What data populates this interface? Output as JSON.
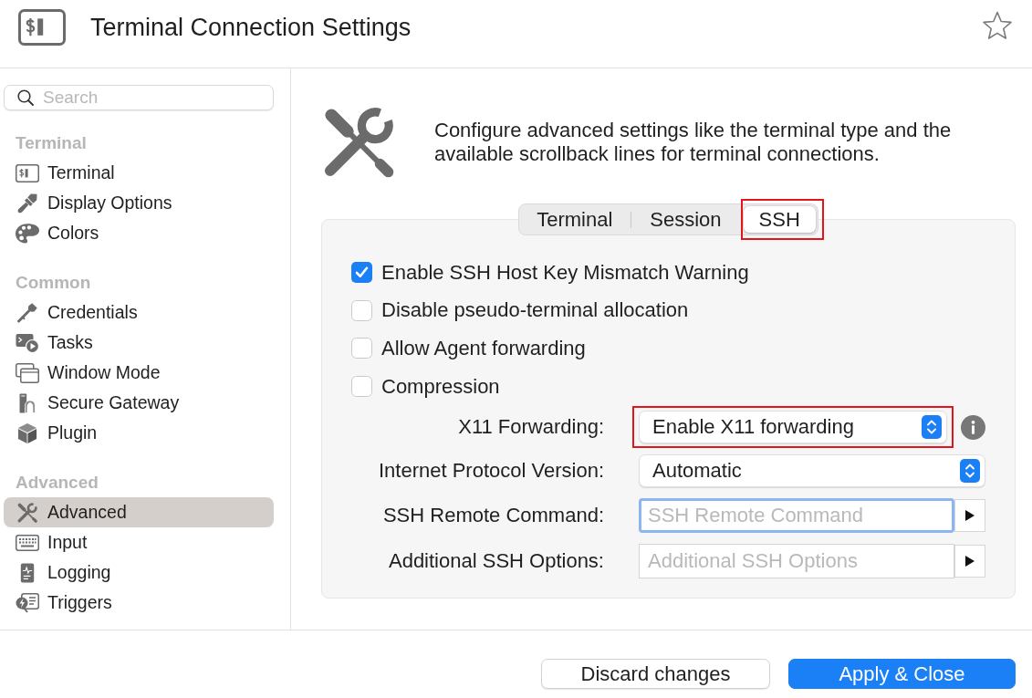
{
  "window": {
    "title": "Terminal Connection Settings",
    "favorite": false
  },
  "sidebar": {
    "search": {
      "placeholder": "Search"
    },
    "sections": [
      {
        "heading": "Terminal",
        "items": [
          {
            "label": "Terminal",
            "kind": "terminal",
            "selected": false
          },
          {
            "label": "Display Options",
            "kind": "paintbrush",
            "selected": false
          },
          {
            "label": "Colors",
            "kind": "palette",
            "selected": false
          }
        ]
      },
      {
        "heading": "Common",
        "items": [
          {
            "label": "Credentials",
            "kind": "key",
            "selected": false
          },
          {
            "label": "Tasks",
            "kind": "tasks",
            "selected": false
          },
          {
            "label": "Window Mode",
            "kind": "windows",
            "selected": false
          },
          {
            "label": "Secure Gateway",
            "kind": "gateway",
            "selected": false
          },
          {
            "label": "Plugin",
            "kind": "cube",
            "selected": false
          }
        ]
      },
      {
        "heading": "Advanced",
        "items": [
          {
            "label": "Advanced",
            "kind": "tools",
            "selected": true
          },
          {
            "label": "Input",
            "kind": "keyboard",
            "selected": false
          },
          {
            "label": "Logging",
            "kind": "logging",
            "selected": false
          },
          {
            "label": "Triggers",
            "kind": "triggers",
            "selected": false
          }
        ]
      }
    ]
  },
  "intro": {
    "description": "Configure advanced settings like the terminal type and the available scrollback lines for terminal connections."
  },
  "tabs": [
    {
      "label": "Terminal",
      "selected": false,
      "highlighted": false
    },
    {
      "label": "Session",
      "selected": false,
      "highlighted": false
    },
    {
      "label": "SSH",
      "selected": true,
      "highlighted": true
    }
  ],
  "options": [
    {
      "label": "Enable SSH Host Key Mismatch Warning",
      "checked": true
    },
    {
      "label": "Disable pseudo-terminal allocation",
      "checked": false
    },
    {
      "label": "Allow Agent forwarding",
      "checked": false
    },
    {
      "label": "Compression",
      "checked": false
    }
  ],
  "fields": [
    {
      "kind": "popup",
      "label": "X11 Forwarding:",
      "value": "Enable X11 forwarding",
      "highlighted": true,
      "info": true
    },
    {
      "kind": "popup",
      "label": "Internet Protocol Version:",
      "value": "Automatic",
      "highlighted": false,
      "info": false
    },
    {
      "kind": "text",
      "label": "SSH Remote Command:",
      "placeholder": "SSH Remote Command",
      "focused": true,
      "highlighted": false
    },
    {
      "kind": "text",
      "label": "Additional SSH Options:",
      "placeholder": "Additional SSH Options",
      "focused": false,
      "highlighted": false
    }
  ],
  "footer": {
    "buttons": [
      {
        "label": "Discard changes",
        "kind": "secondary"
      },
      {
        "label": "Apply & Close",
        "kind": "primary"
      }
    ]
  }
}
